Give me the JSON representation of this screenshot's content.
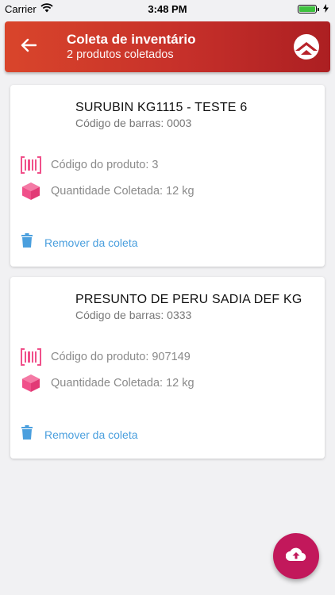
{
  "status_bar": {
    "carrier": "Carrier",
    "time": "3:48 PM"
  },
  "header": {
    "title": "Coleta de inventário",
    "subtitle": "2 produtos coletados",
    "back_icon": "arrow-left-icon",
    "logo_icon": "brand-logo-icon",
    "colors": {
      "gradient_start": "#d9452b",
      "gradient_end": "#ac1f22"
    }
  },
  "products": [
    {
      "name": "SURUBIN KG1115 - TESTE 6",
      "barcode": "Código de barras: 0003",
      "product_code": "Código do produto: 3",
      "quantity": "Quantidade Coletada: 12 kg",
      "remove_label": "Remover da coleta"
    },
    {
      "name": "PRESUNTO DE PERU SADIA DEF KG",
      "barcode": "Código de barras: 0333",
      "product_code": "Código do produto: 907149",
      "quantity": "Quantidade Coletada: 12 kg",
      "remove_label": "Remover da coleta"
    }
  ],
  "fab": {
    "icon": "cloud-upload-icon",
    "color": "#c2185b"
  },
  "colors": {
    "accent_pink": "#f0508a",
    "link_blue": "#4a9fde"
  }
}
